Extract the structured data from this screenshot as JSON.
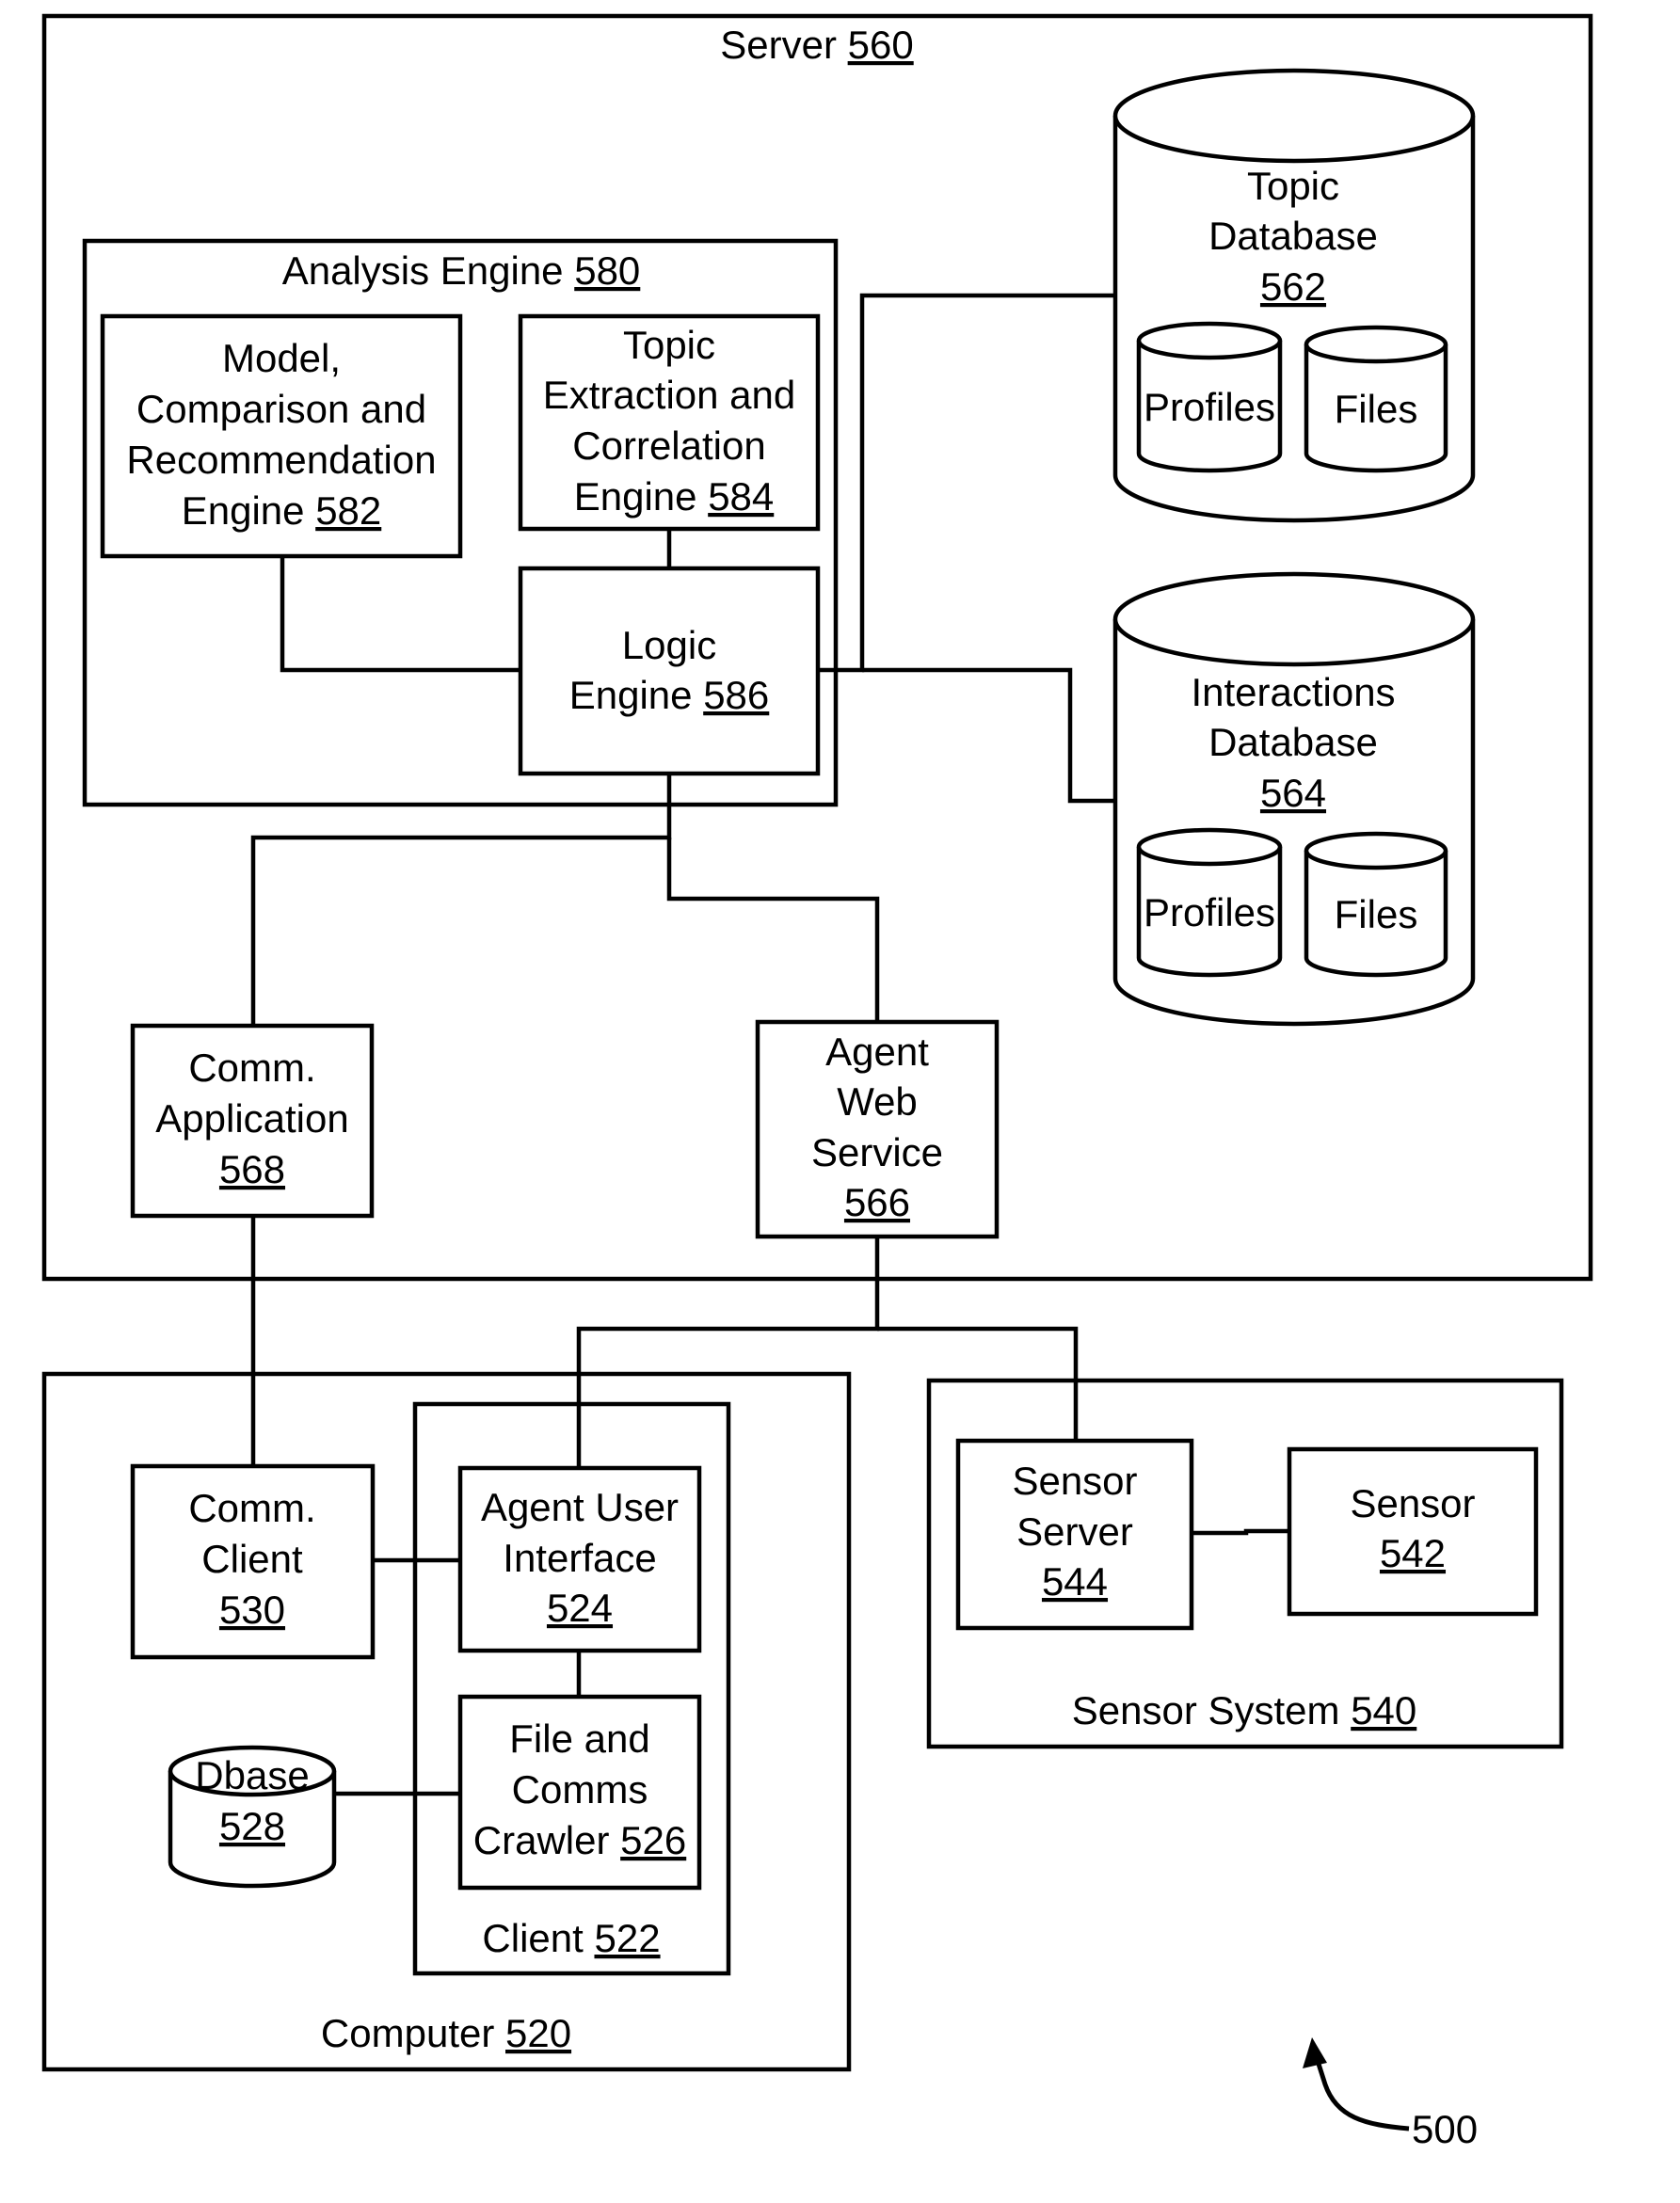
{
  "figure_number": "500",
  "server": {
    "label": "Server",
    "ref": "560"
  },
  "analysis_engine": {
    "label": "Analysis Engine",
    "ref": "580"
  },
  "model_engine": {
    "lines": [
      "Model,",
      "Comparison and",
      "Recommendation",
      "Engine"
    ],
    "ref": "582"
  },
  "topic_extraction": {
    "lines": [
      "Topic",
      "Extraction and",
      "Correlation",
      "Engine"
    ],
    "ref": "584"
  },
  "logic_engine": {
    "lines": [
      "Logic",
      "Engine"
    ],
    "ref": "586"
  },
  "topic_db": {
    "lines": [
      "Topic",
      "Database"
    ],
    "ref": "562",
    "sub": [
      "Profiles",
      "Files"
    ]
  },
  "interactions_db": {
    "lines": [
      "Interactions",
      "Database"
    ],
    "ref": "564",
    "sub": [
      "Profiles",
      "Files"
    ]
  },
  "comm_application": {
    "lines": [
      "Comm.",
      "Application"
    ],
    "ref": "568"
  },
  "agent_web_service": {
    "lines": [
      "Agent",
      "Web",
      "Service"
    ],
    "ref": "566"
  },
  "computer": {
    "label": "Computer",
    "ref": "520"
  },
  "client": {
    "label": "Client",
    "ref": "522"
  },
  "comm_client": {
    "lines": [
      "Comm.",
      "Client"
    ],
    "ref": "530"
  },
  "agent_ui": {
    "lines": [
      "Agent User",
      "Interface"
    ],
    "ref": "524"
  },
  "crawler": {
    "lines": [
      "File and",
      "Comms",
      "Crawler"
    ],
    "ref": "526"
  },
  "dbase": {
    "lines": [
      "Dbase"
    ],
    "ref": "528"
  },
  "sensor_system": {
    "label": "Sensor System",
    "ref": "540"
  },
  "sensor_server": {
    "lines": [
      "Sensor",
      "Server"
    ],
    "ref": "544"
  },
  "sensor": {
    "lines": [
      "Sensor"
    ],
    "ref": "542"
  }
}
